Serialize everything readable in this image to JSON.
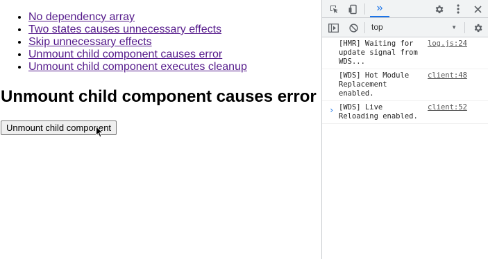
{
  "page": {
    "links": [
      "No dependency array",
      "Two states causes unnecessary effects",
      "Skip unnecessary effects",
      "Unmount child component causes error",
      "Unmount child component executes cleanup"
    ],
    "heading": "Unmount child component causes error",
    "unmount_button_label": "Unmount child component"
  },
  "devtools": {
    "more_tabs_label": "»",
    "context": "top",
    "accent_color": "#1a73e8",
    "messages": [
      {
        "text": "[HMR] Waiting for update signal from WDS...",
        "source": "log.js:24"
      },
      {
        "text": "[WDS] Hot Module Replacement enabled.",
        "source": "client:48"
      },
      {
        "text": "[WDS] Live Reloading enabled.",
        "source": "client:52"
      }
    ],
    "prompt_symbol": "›",
    "icons": [
      "inspect-element-icon",
      "device-toolbar-icon",
      "settings-icon",
      "more-vertical-icon",
      "close-icon",
      "sidebar-toggle-icon",
      "clear-console-icon",
      "console-settings-icon"
    ]
  }
}
